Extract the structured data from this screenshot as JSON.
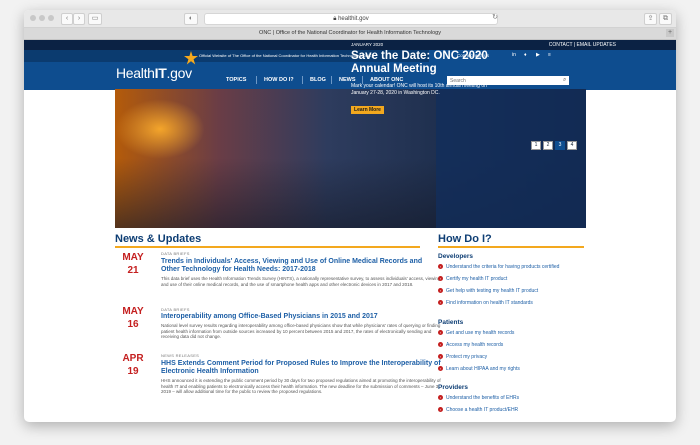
{
  "browser": {
    "url": "healthit.gov",
    "tab_title": "ONC | Office of the National Coordinator for Health Information Technology",
    "new_tab_label": "+"
  },
  "header": {
    "top_links": "CONTACT  |  EMAIL UPDATES",
    "official_text": "Official Website of The Office of the National Coordinator for Health Information Technology (ONC)",
    "connect_label": "Connect with us",
    "social": [
      "in",
      "♦",
      "▶",
      "≡"
    ],
    "logo_prefix": "Health",
    "logo_mid": "IT",
    "logo_suffix": ".gov",
    "nav": [
      "TOPICS",
      "HOW DO I?",
      "BLOG",
      "NEWS",
      "ABOUT ONC"
    ],
    "search_placeholder": "Search"
  },
  "hero": {
    "eyebrow": "JANUARY 2020",
    "title": "Save the Date: ONC 2020 Annual Meeting",
    "text": "Mark your calendar! ONC will host its 10th annual meeting on January 27-28, 2020 in Washington DC.",
    "cta": "Learn More",
    "pages": [
      "1",
      "2",
      "3",
      "4"
    ]
  },
  "news": {
    "heading": "News & Updates",
    "items": [
      {
        "month": "MAY",
        "day": "21",
        "category": "DATA BRIEFS",
        "title": "Trends in Individuals' Access, Viewing and Use of Online Medical Records and Other Technology for Health Needs: 2017-2018",
        "body": "This data brief uses the Health Information Trends Survey (HINTS), a nationally representative survey, to assess individuals' access, viewing and use of their online medical records, and the use of smartphone health apps and other electronic devices in 2017 and 2018."
      },
      {
        "month": "MAY",
        "day": "16",
        "category": "DATA BRIEFS",
        "title": "Interoperability among Office-Based Physicians in 2015 and 2017",
        "body": "National level survey results regarding interoperability among office-based physicians show that while physicians' rates of querying or finding patient health information from outside sources increased by 10 percent between 2015 and 2017, the rates of electronically sending and receiving data did not change."
      },
      {
        "month": "APR",
        "day": "19",
        "category": "NEWS RELEASES",
        "title": "HHS Extends Comment Period for Proposed Rules to Improve the Interoperability of Electronic Health Information",
        "body": "HHS announced it is extending the public comment period by 30 days for two proposed regulations aimed at promoting the interoperability of health IT and enabling patients to electronically access their health information. The new deadline for the submission of comments – June 3, 2019 – will allow additional time for the public to review the proposed regulations."
      }
    ]
  },
  "howdoi": {
    "heading": "How Do I?",
    "groups": [
      {
        "name": "Developers",
        "links": [
          "Understand the criteria for having products certified",
          "Certify my health IT product",
          "Get help with testing my health IT product",
          "Find information on health IT standards"
        ]
      },
      {
        "name": "Patients",
        "links": [
          "Get and use my health records",
          "Access my health records",
          "Protect my privacy",
          "Learn about HIPAA and my rights"
        ]
      },
      {
        "name": "Providers",
        "links": [
          "Understand the benefits of EHRs",
          "Choose a health IT product/EHR"
        ]
      }
    ]
  },
  "colors": {
    "brand_blue": "#0e4d8f",
    "accent_gold": "#f3a81e",
    "date_red": "#c41f1f"
  }
}
